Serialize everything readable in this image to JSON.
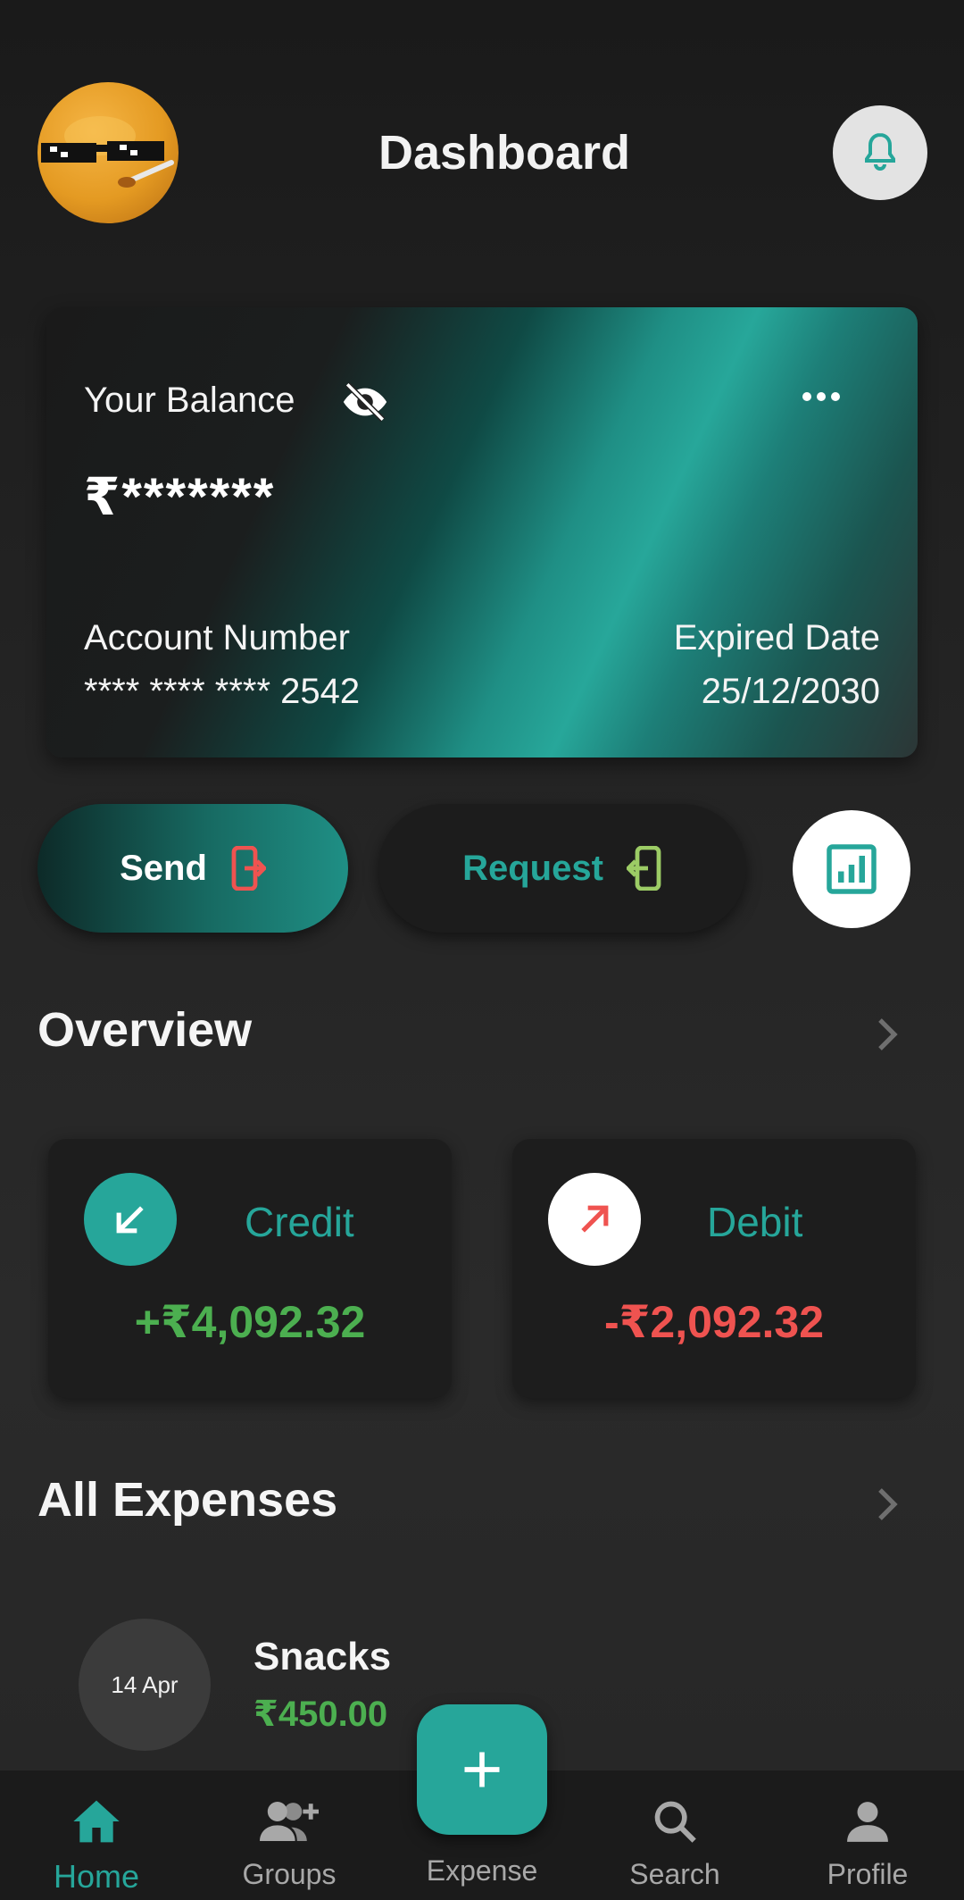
{
  "header": {
    "title": "Dashboard",
    "avatar_icon": "emoji-avatar-with-sunglasses",
    "bell_icon": "bell-icon"
  },
  "balance_card": {
    "balance_label": "Your Balance",
    "balance_value": "₹*******",
    "visibility_icon": "eye-off-icon",
    "more_icon": "more-horizontal-icon",
    "account_label": "Account Number",
    "account_value": "**** **** **** 2542",
    "expiry_label": "Expired Date",
    "expiry_value": "25/12/2030"
  },
  "actions": {
    "send_label": "Send",
    "request_label": "Request",
    "stats_icon": "bar-chart-icon"
  },
  "overview": {
    "title": "Overview",
    "credit": {
      "label": "Credit",
      "amount": "+₹4,092.32",
      "color": "#4caf50"
    },
    "debit": {
      "label": "Debit",
      "amount": "-₹2,092.32",
      "color": "#ef5350"
    }
  },
  "expenses": {
    "title": "All Expenses",
    "items": [
      {
        "date": "14 Apr",
        "title": "Snacks",
        "amount": "₹450.00"
      }
    ]
  },
  "bottom_nav": {
    "items": [
      {
        "label": "Home",
        "icon": "home-icon",
        "active": true
      },
      {
        "label": "Groups",
        "icon": "group-add-icon",
        "active": false
      },
      {
        "label": "Expense",
        "icon": "plus-icon",
        "active": false
      },
      {
        "label": "Search",
        "icon": "search-icon",
        "active": false
      },
      {
        "label": "Profile",
        "icon": "person-icon",
        "active": false
      }
    ]
  },
  "colors": {
    "accent": "#26a69a",
    "background": "#1f1f1f",
    "send_icon": "#ef5350",
    "request_icon": "#9ccc65"
  }
}
